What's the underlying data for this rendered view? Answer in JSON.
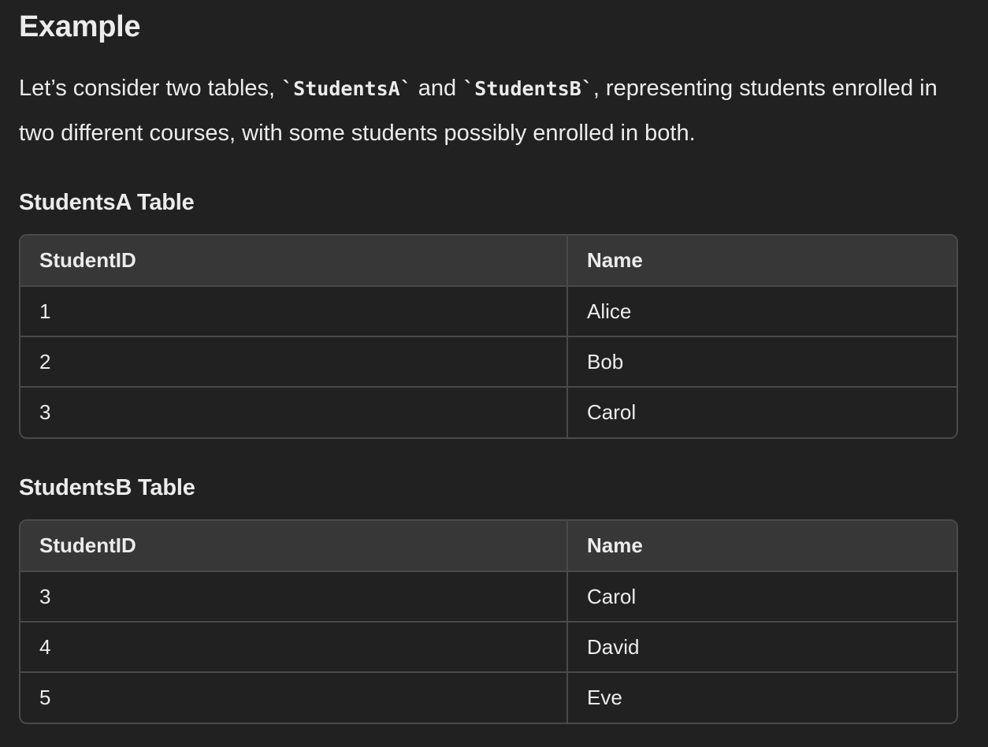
{
  "heading": "Example",
  "intro": {
    "text_1": "Let’s consider two tables, ",
    "code_1": "`StudentsA`",
    "text_2": " and ",
    "code_2": "`StudentsB`",
    "text_3": ", representing students enrolled in two different courses, with some students possibly enrolled in both."
  },
  "table_a": {
    "title": "StudentsA Table",
    "headers": [
      "StudentID",
      "Name"
    ],
    "rows": [
      [
        "1",
        "Alice"
      ],
      [
        "2",
        "Bob"
      ],
      [
        "3",
        "Carol"
      ]
    ]
  },
  "table_b": {
    "title": "StudentsB Table",
    "headers": [
      "StudentID",
      "Name"
    ],
    "rows": [
      [
        "3",
        "Carol"
      ],
      [
        "4",
        "David"
      ],
      [
        "5",
        "Eve"
      ]
    ]
  }
}
